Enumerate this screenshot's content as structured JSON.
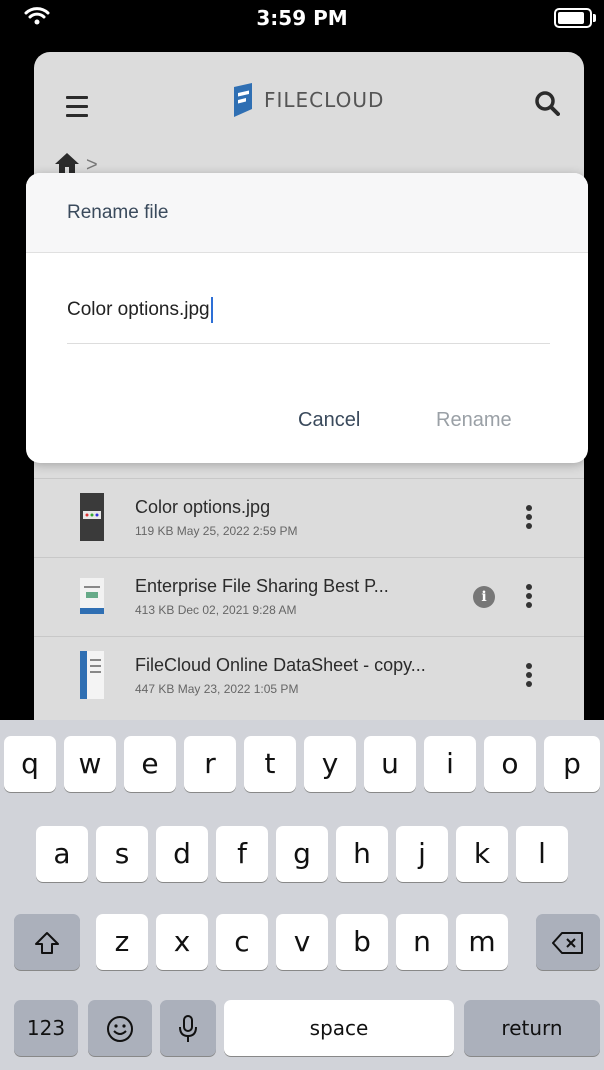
{
  "status_bar": {
    "time": "3:59 PM"
  },
  "header": {
    "logo_text": "FILECLOUD"
  },
  "breadcrumb": {
    "separator": ">"
  },
  "dialog": {
    "title": "Rename file",
    "input_value": "Color options.jpg",
    "cancel_label": "Cancel",
    "rename_label": "Rename"
  },
  "files": [
    {
      "name": "Color options.jpg",
      "meta": "119 KB May 25, 2022 2:59 PM",
      "info": false
    },
    {
      "name": "Enterprise File Sharing Best P...",
      "meta": "413 KB Dec 02, 2021 9:28 AM",
      "info": true
    },
    {
      "name": "FileCloud Online DataSheet - copy...",
      "meta": "447 KB May 23, 2022 1:05 PM",
      "info": false
    }
  ],
  "keyboard": {
    "row1": [
      "q",
      "w",
      "e",
      "r",
      "t",
      "y",
      "u",
      "i",
      "o",
      "p"
    ],
    "row2": [
      "a",
      "s",
      "d",
      "f",
      "g",
      "h",
      "j",
      "k",
      "l"
    ],
    "row3": [
      "z",
      "x",
      "c",
      "v",
      "b",
      "n",
      "m"
    ],
    "numbers_label": "123",
    "space_label": "space",
    "return_label": "return",
    "info_glyph": "i"
  },
  "colors": {
    "accent": "#2d6fd6",
    "logo_blue": "#2f6fb3"
  }
}
